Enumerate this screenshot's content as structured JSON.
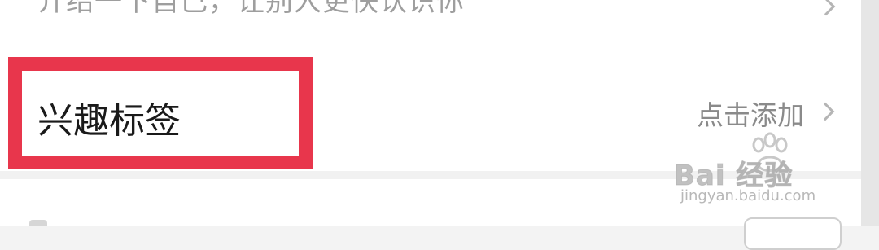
{
  "profile_rows": {
    "intro": {
      "text": "介绍一下自己，让别人更快认识你"
    },
    "interest_tags": {
      "label": "兴趣标签",
      "action": "点击添加"
    }
  },
  "annotation": {
    "highlight_color": "#e8364c"
  },
  "icons": {
    "chevron": "chevron-right-icon"
  },
  "watermark": {
    "brand": "Bai  经验",
    "url": "jingyan.baidu.com"
  }
}
